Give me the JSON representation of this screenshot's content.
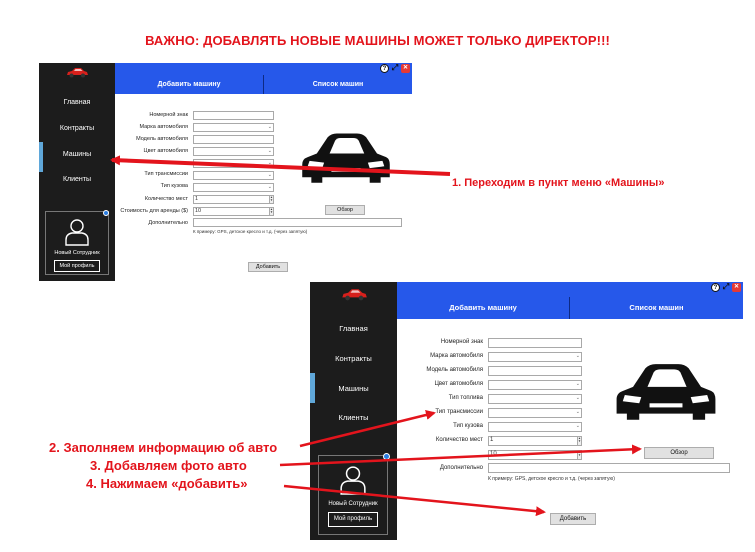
{
  "heading": "ВАЖНО: ДОБАВЛЯТЬ НОВЫЕ МАШИНЫ МОЖЕТ ТОЛЬКО ДИРЕКТОР!!!",
  "colors": {
    "accent_red": "#e3141c",
    "topbar_blue": "#2658ea",
    "sidebar": "#1c1c1c"
  },
  "app": {
    "sidebar": {
      "items": [
        {
          "label": "Главная",
          "active": false
        },
        {
          "label": "Контракты",
          "active": false
        },
        {
          "label": "Машины",
          "active": true
        },
        {
          "label": "Клиенты",
          "active": false
        }
      ],
      "profile_name": "Новый Сотрудник",
      "profile_button": "Мой профиль",
      "logo_icon": "red-car-logo-icon",
      "avatar_icon": "person-icon"
    },
    "window_icons": [
      "help-icon",
      "expand-icon",
      "close-icon"
    ],
    "window_icon_glyphs": {
      "help": "?",
      "expand": "⤢",
      "close": "✕"
    },
    "tabs": [
      {
        "label": "Добавить машину"
      },
      {
        "label": "Список машин"
      }
    ],
    "form1_labels": {
      "plate": "Номерной знак",
      "brand": "Марка автомобиля",
      "model": "Модель автомобиля",
      "color": "Цвет автомобиля",
      "transmission": "Тип трансмиссии",
      "body": "Тип кузова",
      "seats": "Количество мест",
      "price": "Стоимость для аренды ($)",
      "extra": "Дополнительно"
    },
    "form2_labels": {
      "plate": "Номерной знак",
      "brand": "Марка автомобиля",
      "model": "Модель автомобиля",
      "color": "Цвет автомобиля",
      "fuel": "Тип топлива",
      "transmission": "Тип трансмиссии",
      "body": "Тип кузова",
      "seats": "Количество мест",
      "extra": "Дополнительно"
    },
    "values": {
      "seats": "1",
      "price": "10"
    },
    "browse_button": "Обзор",
    "extra_hint": "К примеру: GPS, детское кресло и т.д. (через запятую)",
    "add_button": "Добавить",
    "car_photo_icon": "car-silhouette-icon"
  },
  "annotations": {
    "step1": "1. Переходим в пункт меню «Машины»",
    "step2": "2. Заполняем информацию об авто",
    "step3": "3. Добавляем фото авто",
    "step4": "4. Нажимаем «добавить»"
  }
}
